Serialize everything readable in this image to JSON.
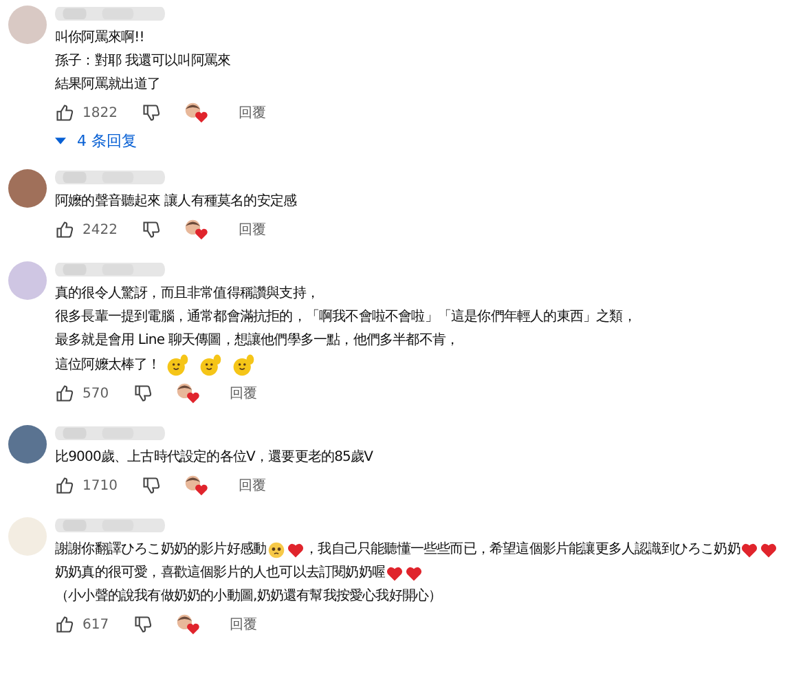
{
  "comments": [
    {
      "lines": [
        [
          {
            "kind": "text",
            "text": "叫你阿罵來啊!!"
          }
        ],
        [
          {
            "kind": "text",
            "text": "孫子：對耶 我還可以叫阿罵來"
          }
        ],
        [
          {
            "kind": "text",
            "text": "結果阿罵就出道了"
          }
        ]
      ],
      "likes": "1822",
      "reply_label": "回覆",
      "replies_toggle": "4 条回复"
    },
    {
      "lines": [
        [
          {
            "kind": "text",
            "text": "阿嬤的聲音聽起來 讓人有種莫名的安定感"
          }
        ]
      ],
      "likes": "2422",
      "reply_label": "回覆"
    },
    {
      "lines": [
        [
          {
            "kind": "text",
            "text": "真的很令人驚訝，而且非常值得稱讚與支持，"
          }
        ],
        [
          {
            "kind": "text",
            "text": "很多長輩一提到電腦，通常都會滿抗拒的，「啊我不會啦不會啦」「這是你們年輕人的東西」之類，"
          }
        ],
        [
          {
            "kind": "text",
            "text": "最多就是會用 Line 聊天傳圖，想讓他們學多一點，他們多半都不肯，"
          }
        ],
        [
          {
            "kind": "text",
            "text": "這位阿嬤太棒了！"
          },
          {
            "kind": "hand"
          },
          {
            "kind": "hand"
          },
          {
            "kind": "hand"
          }
        ]
      ],
      "likes": "570",
      "reply_label": "回覆"
    },
    {
      "lines": [
        [
          {
            "kind": "text",
            "text": "比9000歲、上古時代設定的各位V，還要更老的85歲V"
          }
        ]
      ],
      "likes": "1710",
      "reply_label": "回覆"
    },
    {
      "lines": [
        [
          {
            "kind": "text",
            "text": "謝謝你翻譯ひろこ奶奶的影片好感動"
          },
          {
            "kind": "face"
          },
          {
            "kind": "heart"
          },
          {
            "kind": "text",
            "text": "，我自己只能聽懂一些些而已，希望這個影片能讓更多人認識到ひろこ奶奶"
          },
          {
            "kind": "heart"
          },
          {
            "kind": "heart"
          }
        ],
        [
          {
            "kind": "text",
            "text": "奶奶真的很可愛，喜歡這個影片的人也可以去訂閱奶奶喔"
          },
          {
            "kind": "heart"
          },
          {
            "kind": "heart"
          }
        ],
        [
          {
            "kind": "text",
            "text": "（小小聲的說我有做奶奶的小動圖,奶奶還有幫我按愛心我好開心）"
          }
        ]
      ],
      "likes": "617",
      "reply_label": "回覆"
    }
  ]
}
